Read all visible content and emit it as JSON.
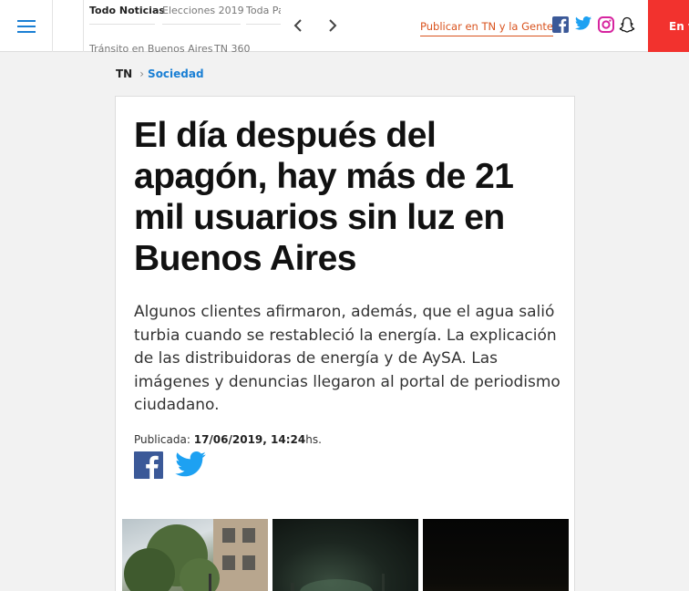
{
  "header": {
    "nav": [
      "Todo Noticias",
      "Elecciones 2019",
      "Toda Pa",
      "Tránsito en Buenos Aires",
      "TN 360"
    ],
    "publish_label": "Publicar en TN y la Gente",
    "red_button": "En v",
    "icons": {
      "menu": "hamburger-menu-icon",
      "prev": "chevron-left-icon",
      "next": "chevron-right-icon",
      "facebook": "facebook-icon",
      "twitter": "twitter-icon",
      "instagram": "instagram-icon",
      "snapchat": "snapchat-icon"
    },
    "colors": {
      "accent": "#1a7fd4",
      "publish": "#d9531e",
      "red": "#f2322e"
    }
  },
  "breadcrumb": {
    "home": "TN",
    "section": "Sociedad"
  },
  "article": {
    "title": "El día después del apagón, hay más de 21 mil usuarios sin luz en Buenos Aires",
    "lead": "Algunos clientes afirmaron, además, que el agua salió turbia cuando se restableció la energía. La explicación de las distribuidoras de energía y de AySA. Las imágenes y denuncias llegaron al portal de periodismo ciudadano.",
    "published_label": "Publicada:",
    "published_date": "17/06/2019, 14:24",
    "published_suffix": "hs.",
    "share_icons": [
      "facebook-icon",
      "twitter-icon"
    ]
  }
}
